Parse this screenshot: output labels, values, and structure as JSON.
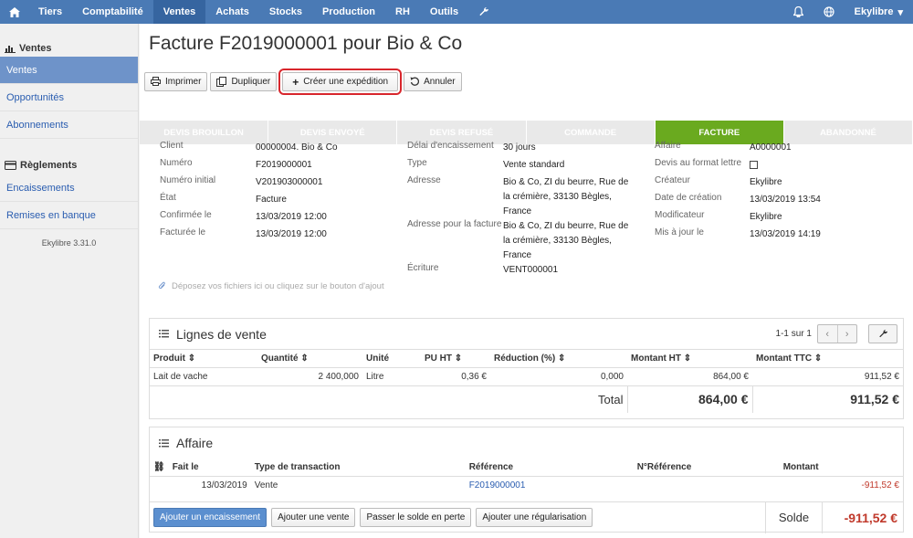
{
  "nav": {
    "items": [
      "Tiers",
      "Comptabilité",
      "Ventes",
      "Achats",
      "Stocks",
      "Production",
      "RH",
      "Outils"
    ],
    "active": "Ventes",
    "user": "Ekylibre"
  },
  "sidebar": {
    "section1": "Ventes",
    "items1": [
      "Ventes",
      "Opportunités",
      "Abonnements"
    ],
    "section2": "Règlements",
    "items2": [
      "Encaissements",
      "Remises en banque"
    ],
    "version": "Ekylibre 3.31.0"
  },
  "page": {
    "title": "Facture F2019000001 pour Bio & Co"
  },
  "toolbar": {
    "print": "Imprimer",
    "duplicate": "Dupliquer",
    "create_shipment": "Créer une expédition",
    "cancel": "Annuler"
  },
  "steps": [
    "Devis brouillon",
    "Devis envoyé",
    "Devis refusé",
    "Commande",
    "Facture",
    "Abandonné"
  ],
  "active_step": "Facture",
  "info": {
    "col1": [
      {
        "label": "Client",
        "value": "00000004. Bio & Co",
        "link": true
      },
      {
        "label": "Numéro",
        "value": "F2019000001"
      },
      {
        "label": "Numéro initial",
        "value": "V201903000001"
      },
      {
        "label": "État",
        "value": "Facture"
      },
      {
        "label": "Confirmée le",
        "value": "13/03/2019 12:00"
      },
      {
        "label": "Facturée le",
        "value": "13/03/2019 12:00"
      }
    ],
    "col2": [
      {
        "label": "Délai d'encaissement",
        "value": "30 jours"
      },
      {
        "label": "Type",
        "value": "Vente standard"
      },
      {
        "label": "Adresse",
        "value": "Bio & Co, ZI du beurre, Rue de la crémière, 33130 Bègles, France"
      },
      {
        "label": "Adresse pour la facture",
        "value": "Bio & Co, ZI du beurre, Rue de la crémière, 33130 Bègles, France"
      },
      {
        "label": "Écriture",
        "value": "VENT000001",
        "link": true
      }
    ],
    "col3": [
      {
        "label": "Affaire",
        "value": "A0000001",
        "link": true
      },
      {
        "label": "Devis au format lettre",
        "value": "",
        "checkbox": true
      },
      {
        "label": "Créateur",
        "value": "Ekylibre"
      },
      {
        "label": "Date de création",
        "value": "13/03/2019 13:54"
      },
      {
        "label": "Modificateur",
        "value": "Ekylibre"
      },
      {
        "label": "Mis à jour le",
        "value": "13/03/2019 14:19"
      }
    ]
  },
  "dropzone": "Déposez vos fichiers ici ou cliquez sur le bouton d'ajout",
  "lines": {
    "title": "Lignes de vente",
    "pager": "1-1 sur 1",
    "headers": [
      "Produit",
      "Quantité",
      "Unité",
      "PU HT",
      "Réduction (%)",
      "Montant HT",
      "Montant TTC"
    ],
    "rows": [
      [
        "Lait de vache",
        "2 400,000",
        "Litre",
        "0,36 €",
        "0,000",
        "864,00 €",
        "911,52 €"
      ]
    ],
    "total_label": "Total",
    "total_ht": "864,00 €",
    "total_ttc": "911,52 €"
  },
  "affair": {
    "title": "Affaire",
    "headers": [
      "Fait le",
      "Type de transaction",
      "Référence",
      "N°Référence",
      "Montant"
    ],
    "rows": [
      [
        "13/03/2019",
        "Vente",
        "F2019000001",
        "",
        "-911,52 €"
      ]
    ],
    "buttons": [
      "Ajouter un encaissement",
      "Ajouter une vente",
      "Passer le solde en perte",
      "Ajouter une régularisation"
    ],
    "balance_label": "Solde",
    "balance": "-911,52 €"
  },
  "colors": {
    "nav": "#4a7ab5",
    "active_step": "#6aaa1f",
    "highlight": "#d8262c"
  }
}
